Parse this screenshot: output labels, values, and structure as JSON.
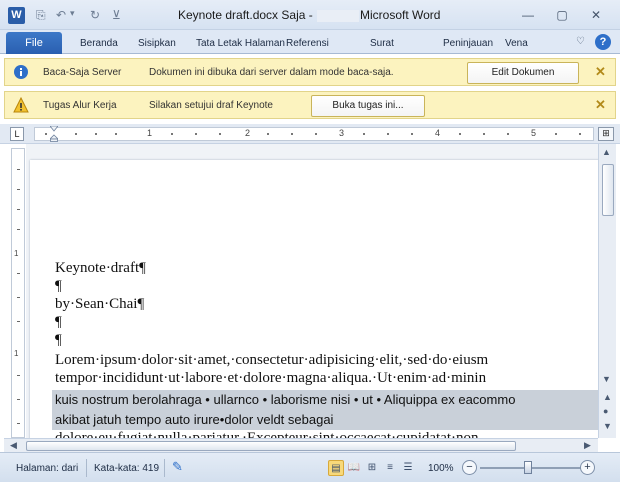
{
  "titlebar": {
    "app_icon_letter": "W",
    "document_title": "Keynote draft.docx Saja -",
    "app_name": "Microsoft Word",
    "qat": {
      "save": "⎘",
      "undo": "↶",
      "undo_dd": "▾",
      "redo": "↻",
      "customize": "⊻"
    },
    "window_controls": {
      "minimize": "—",
      "restore": "▢",
      "close": "✕"
    }
  },
  "ribbon": {
    "file_tab": "File",
    "tabs": [
      "Beranda",
      "Sisipkan",
      "Tata Letak Halaman",
      "Referensi",
      "Surat",
      "Peninjauan",
      "Vena"
    ],
    "collapse_icon": "♡",
    "help_icon": "?"
  },
  "message_bars": [
    {
      "title": "Baca-Saja Server",
      "text": "Dokumen ini dibuka dari server dalam mode baca-saja.",
      "button": "Edit Dokumen",
      "close": "✕"
    },
    {
      "title": "Tugas Alur Kerja",
      "text": "Silakan setujui draf Keynote",
      "button": "Buka tugas ini...",
      "close": "✕"
    }
  ],
  "ruler": {
    "tab_selector": "L",
    "numbers": [
      "1",
      "2",
      "3",
      "4",
      "5"
    ],
    "view_ruler_icon": "⊞"
  },
  "vruler_numbers": [
    "1",
    "1"
  ],
  "document": {
    "lines": [
      "Keynote·draft¶",
      "¶",
      "by·Sean·Chai¶",
      "¶",
      "¶",
      "Lorem·ipsum·dolor·sit·amet,·consectetur·adipisicing·elit,·sed·do·eiusm",
      "tempor·incididunt·ut·labore·et·dolore·magna·aliqua.·Ut·enim·ad·minin"
    ],
    "highlighted_lines": [
      "kuis nostrum berolahraga • ullarnco • laborisme nisi • ut • Aliquippa ex eacommo",
      "akibat jatuh tempo auto irure•dolor veldt sebagai"
    ],
    "partial_line": "dolore·eu·fugiat·nulla·pariatur.·Excepteur·sint·occaecat·cupidatat·non"
  },
  "scrollbars": {
    "up": "▲",
    "down": "▼",
    "left": "◀",
    "right": "▶",
    "prev_page": "▲",
    "select_browse": "●",
    "next_page": "▼"
  },
  "status": {
    "page": "Halaman: dari",
    "words": "Kata-kata: 419",
    "proofing_icon": "✎",
    "views": [
      "▤",
      "📖",
      "⊞",
      "≡",
      "☰"
    ],
    "zoom_percent": "100%",
    "zoom_minus": "−",
    "zoom_plus": "+",
    "zoom_level": 1.0
  },
  "colors": {
    "accent": "#2a5da8",
    "message_bar": "#fcf3bf",
    "highlight": "#c9d0d9"
  }
}
